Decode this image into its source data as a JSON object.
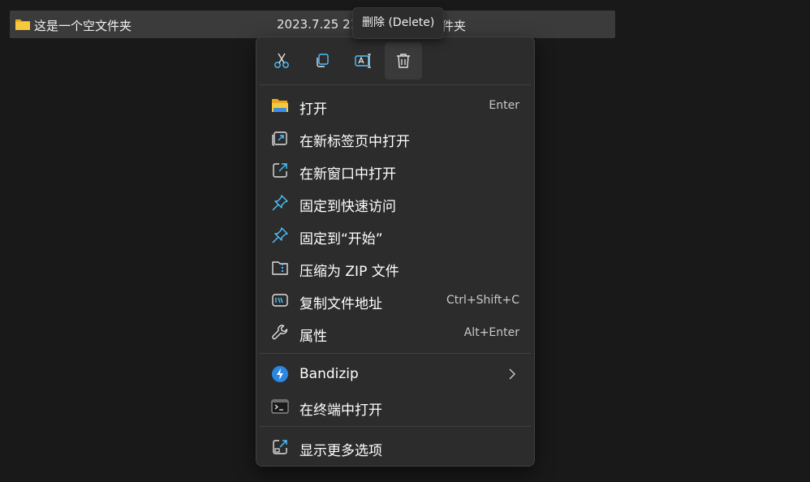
{
  "file_row": {
    "name": "这是一个空文件夹",
    "date": "2023.7.25 21",
    "type": "件夹"
  },
  "tooltip": {
    "text": "删除 (Delete)"
  },
  "toolbar": {
    "buttons": [
      {
        "icon": "cut-icon"
      },
      {
        "icon": "copy-icon"
      },
      {
        "icon": "rename-icon"
      },
      {
        "icon": "delete-icon"
      }
    ]
  },
  "menu": {
    "items": [
      {
        "label": "打开",
        "shortcut": "Enter",
        "icon": "folder-open-icon"
      },
      {
        "label": "在新标签页中打开",
        "shortcut": "",
        "icon": "new-tab-icon"
      },
      {
        "label": "在新窗口中打开",
        "shortcut": "",
        "icon": "new-window-icon"
      },
      {
        "label": "固定到快速访问",
        "shortcut": "",
        "icon": "pin-icon"
      },
      {
        "label": "固定到“开始”",
        "shortcut": "",
        "icon": "pin-icon"
      },
      {
        "label": "压缩为 ZIP 文件",
        "shortcut": "",
        "icon": "zip-icon"
      },
      {
        "label": "复制文件地址",
        "shortcut": "Ctrl+Shift+C",
        "icon": "copy-path-icon"
      },
      {
        "label": "属性",
        "shortcut": "Alt+Enter",
        "icon": "wrench-icon"
      }
    ],
    "extensions": [
      {
        "label": "Bandizip",
        "icon": "bandizip-icon",
        "has_submenu": true
      },
      {
        "label": "在终端中打开",
        "icon": "terminal-icon"
      }
    ],
    "more": {
      "label": "显示更多选项",
      "icon": "more-options-icon"
    }
  },
  "colors": {
    "background": "#191919",
    "menu_bg": "#2c2c2c",
    "accent_blue": "#4cc2ff",
    "folder_yellow": "#f9c73d"
  }
}
